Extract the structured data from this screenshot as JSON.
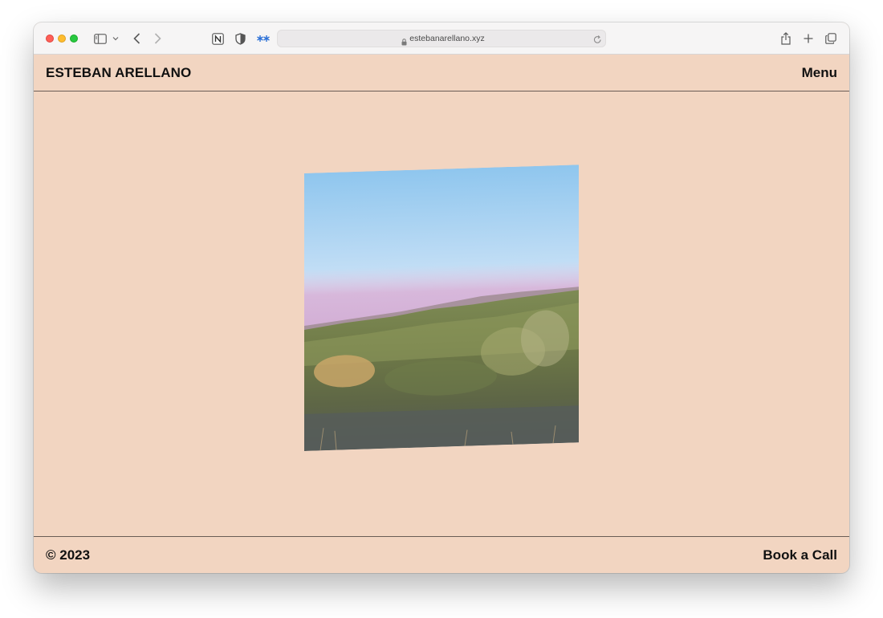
{
  "browser": {
    "url": "estebanarellano.xyz"
  },
  "header": {
    "brand": "ESTEBAN ARELLANO",
    "menu_label": "Menu"
  },
  "footer": {
    "copyright": "© 2023",
    "cta_label": "Book a Call"
  },
  "colors": {
    "page_background": "#f2d5c1",
    "text": "#111111",
    "divider": "#6a5d55"
  },
  "icons": {
    "sidebar": "sidebar-icon",
    "back": "chevron-left-icon",
    "forward": "chevron-right-icon",
    "notion": "notion-icon",
    "privacy": "shield-icon",
    "extension": "asterisk-extension-icon",
    "share": "share-icon",
    "new_tab": "plus-icon",
    "tabs": "tab-overview-icon"
  }
}
